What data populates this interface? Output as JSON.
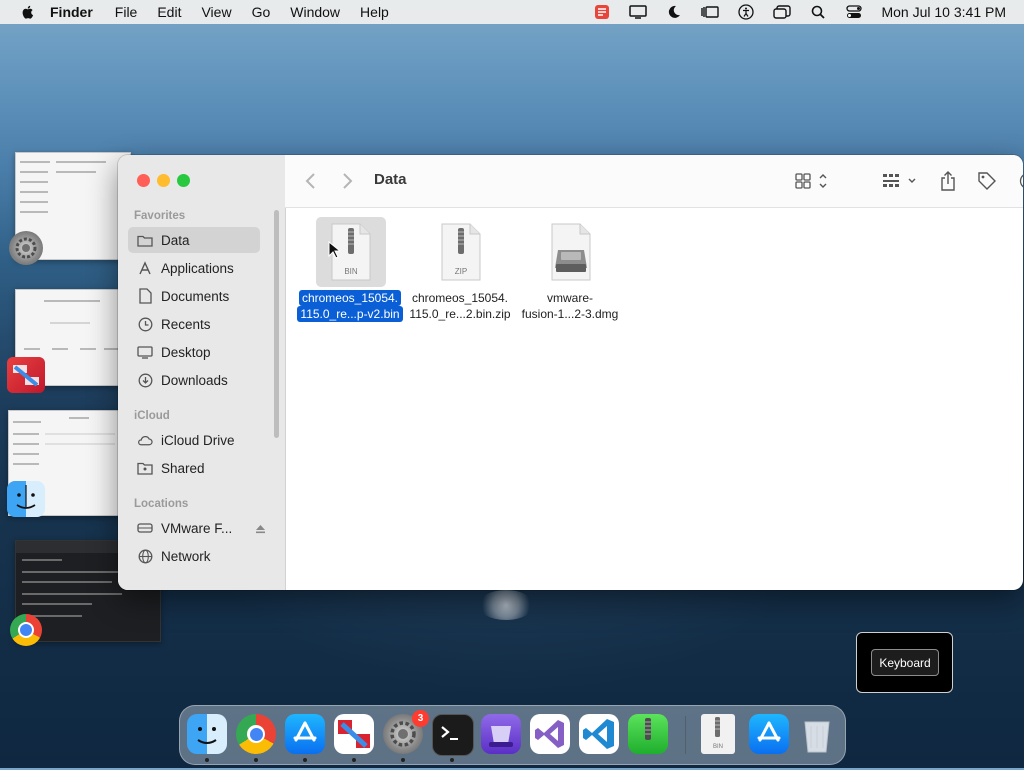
{
  "menubar": {
    "app_name": "Finder",
    "items": [
      "File",
      "Edit",
      "View",
      "Go",
      "Window",
      "Help"
    ],
    "clock": "Mon Jul 10  3:41 PM"
  },
  "finder": {
    "title": "Data",
    "sidebar": {
      "favorites_header": "Favorites",
      "favorites": [
        {
          "label": "Data",
          "icon": "folder-icon"
        },
        {
          "label": "Applications",
          "icon": "applications-icon"
        },
        {
          "label": "Documents",
          "icon": "document-icon"
        },
        {
          "label": "Recents",
          "icon": "clock-icon"
        },
        {
          "label": "Desktop",
          "icon": "desktop-icon"
        },
        {
          "label": "Downloads",
          "icon": "download-icon"
        }
      ],
      "icloud_header": "iCloud",
      "icloud": [
        {
          "label": "iCloud Drive",
          "icon": "cloud-icon"
        },
        {
          "label": "Shared",
          "icon": "shared-folder-icon"
        }
      ],
      "locations_header": "Locations",
      "locations": [
        {
          "label": "VMware F...",
          "icon": "drive-icon"
        },
        {
          "label": "Network",
          "icon": "globe-icon"
        }
      ]
    },
    "files": [
      {
        "line1": "chromeos_15054.",
        "line2": "115.0_re...p-v2.bin",
        "badge": "BIN",
        "selected": true
      },
      {
        "line1": "chromeos_15054.",
        "line2": "115.0_re...2.bin.zip",
        "badge": "ZIP",
        "selected": false
      },
      {
        "line1": "vmware-",
        "line2": "fusion-1...2-3.dmg",
        "badge": "",
        "selected": false
      }
    ]
  },
  "keyboard_button": "Keyboard",
  "dock": {
    "system_settings_badge": "3"
  },
  "colors": {
    "selection": "#0a5fd6",
    "close": "#ff5f57",
    "minimize": "#febc2e",
    "zoom": "#28c840"
  }
}
